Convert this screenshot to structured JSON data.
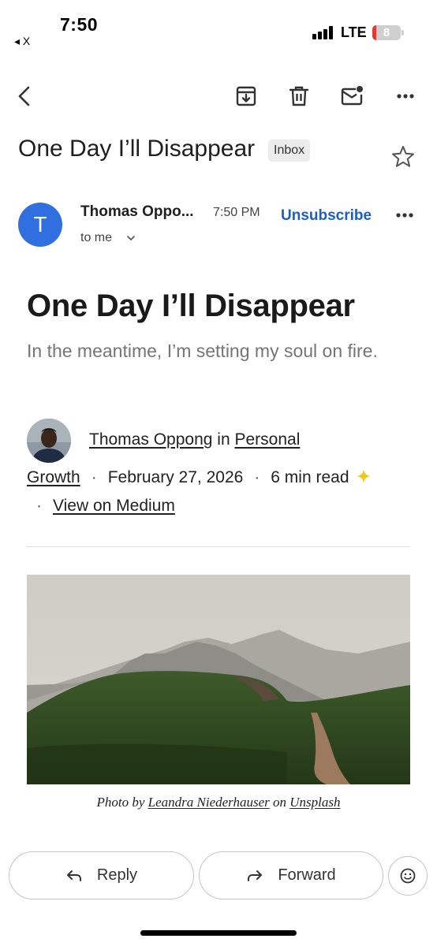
{
  "status_bar": {
    "time": "7:50",
    "back_app": "◂ X",
    "network": "LTE",
    "battery": "8"
  },
  "toolbar": {
    "icons": [
      "back-arrow-icon",
      "archive-icon",
      "trash-icon",
      "mark-unread-icon",
      "more-icon"
    ]
  },
  "email": {
    "subject": "One Day I’ll Disappear",
    "label": "Inbox",
    "sender_name": "Thomas Oppo...",
    "sender_initial": "T",
    "time": "7:50 PM",
    "unsubscribe": "Unsubscribe",
    "recipient": "to me"
  },
  "article": {
    "title": "One Day I’ll Disappear",
    "subtitle": "In the meantime, I’m setting my soul on fire.",
    "author": "Thomas Oppong",
    "in_word": "in",
    "publication_part1": "Personal",
    "publication_part2": "Growth",
    "date": "February 27, 2026",
    "read_time": "6 min read",
    "view_link": "View on Medium",
    "separator": "·",
    "caption_prefix": "Photo by",
    "photographer": "Leandra Niederhauser",
    "caption_on": "on",
    "photo_source": "Unsplash"
  },
  "actions": {
    "reply": "Reply",
    "forward": "Forward"
  },
  "colors": {
    "accent_blue": "#1a5fc9",
    "avatar_blue": "#2f6fe0",
    "sparkle_yellow": "#f5c518"
  }
}
